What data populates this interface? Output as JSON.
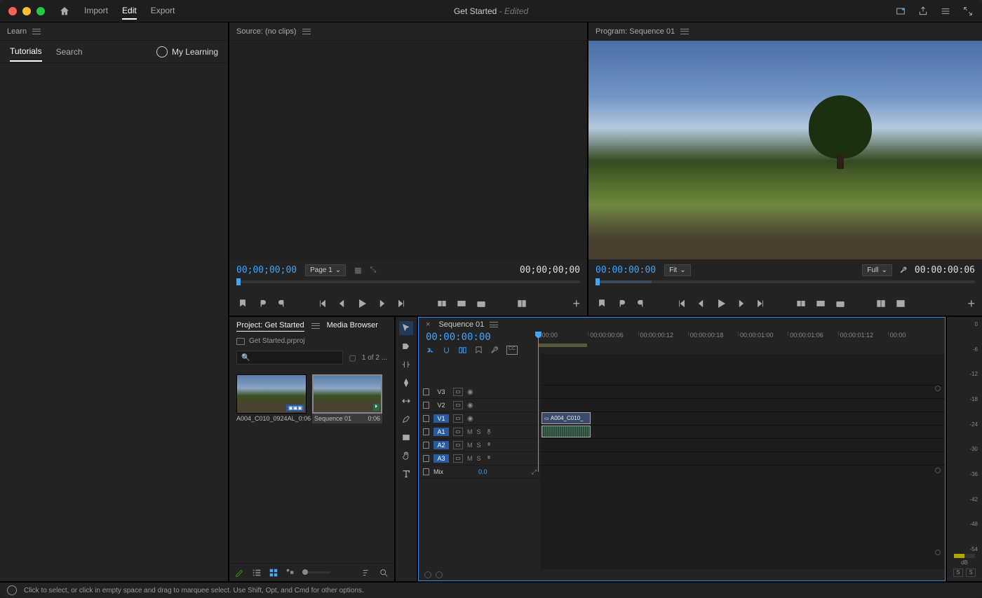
{
  "titlebar": {
    "tabs": [
      "Import",
      "Edit",
      "Export"
    ],
    "activeTab": "Edit",
    "projectName": "Get Started",
    "status": "- Edited"
  },
  "learnPanel": {
    "header": "Learn",
    "tabs": [
      "Tutorials",
      "Search"
    ],
    "activeTab": "Tutorials",
    "myLearning": "My Learning"
  },
  "sourceMonitor": {
    "header": "Source: (no clips)",
    "timecodeLeft": "00;00;00;00",
    "pageSelect": "Page 1",
    "timecodeRight": "00;00;00;00"
  },
  "programMonitor": {
    "header": "Program: Sequence 01",
    "timecodeLeft": "00:00:00:00",
    "zoomSelect": "Fit",
    "resSelect": "Full",
    "timecodeRight": "00:00:00:06"
  },
  "projectPanel": {
    "tabs": [
      "Project: Get Started",
      "Media Browser"
    ],
    "activeTab": "Project: Get Started",
    "path": "Get Started.prproj",
    "searchPlaceholder": "",
    "itemCount": "1 of 2 ...",
    "assets": [
      {
        "name": "A004_C010_0924AL_",
        "dur": "0:06",
        "selected": false
      },
      {
        "name": "Sequence 01",
        "dur": "0:06",
        "selected": true
      }
    ]
  },
  "timeline": {
    "seqName": "Sequence 01",
    "timecode": "00:00:00:00",
    "rulerMarks": [
      ";00:00",
      "00:00:00:06",
      "00:00:00:12",
      "00:00:00:18",
      "00:00:01:00",
      "00:00:01:06",
      "00:00:01:12",
      "00:00"
    ],
    "videoTracks": [
      "V3",
      "V2",
      "V1"
    ],
    "audioTracks": [
      "A1",
      "A2",
      "A3"
    ],
    "targetTracks": [
      "V1",
      "A1",
      "A2",
      "A3"
    ],
    "mixLabel": "Mix",
    "mixVal": "0.0",
    "clipName": "A004_C010_"
  },
  "meter": {
    "marks": [
      "0",
      "-6",
      "-12",
      "-18",
      "-24",
      "-30",
      "-36",
      "-42",
      "-48",
      "-54",
      "dB"
    ]
  },
  "statusbar": {
    "text": "Click to select, or click in empty space and drag to marquee select. Use Shift, Opt, and Cmd for other options."
  }
}
